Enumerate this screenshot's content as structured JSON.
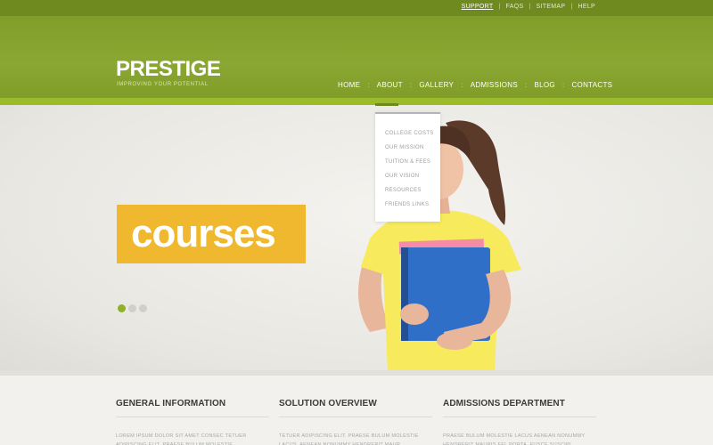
{
  "top_links": [
    {
      "label": "SUPPORT"
    },
    {
      "label": "FAQS"
    },
    {
      "label": "SITEMAP"
    },
    {
      "label": "HELP"
    }
  ],
  "brand": {
    "name": "PRESTIGE",
    "tagline": "IMPROVING YOUR POTENTIAL"
  },
  "nav": [
    {
      "label": "HOME"
    },
    {
      "label": "ABOUT"
    },
    {
      "label": "GALLERY"
    },
    {
      "label": "ADMISSIONS"
    },
    {
      "label": "BLOG"
    },
    {
      "label": "CONTACTS"
    }
  ],
  "dropdown": [
    {
      "label": "COLLEGE COSTS"
    },
    {
      "label": "OUR MISSION"
    },
    {
      "label": "TUITION & FEES"
    },
    {
      "label": "OUR VISION"
    },
    {
      "label": "RESOURCES"
    },
    {
      "label": "FRIENDS LINKS"
    }
  ],
  "hero": {
    "banner_text": "courses",
    "active_slide": 1,
    "slide_count": 3
  },
  "columns": [
    {
      "title": "GENERAL INFORMATION",
      "text": "LOREM IPSUM DOLOR SIT AMET CONSEC TETUER ADIPISCING ELIT. PRAESE BULUM MOLESTIE"
    },
    {
      "title": "SOLUTION OVERVIEW",
      "text": "TETUER ADIPISCING ELIT. PRAESE BULUM MOLESTIE LACUS. AENEAN NONUMMY HENDRERIT MAUR"
    },
    {
      "title": "ADMISSIONS DEPARTMENT",
      "text": "PRAESE BULUM MOLESTIE LACUS AENEAN NONUMMY HENDRERIT MAURIS FEL PORTA. FUSCE SUSCIPI"
    }
  ],
  "colors": {
    "brand_green": "#8aa732",
    "accent_yellow": "#f0b82e",
    "dot_active": "#8fb02a"
  }
}
